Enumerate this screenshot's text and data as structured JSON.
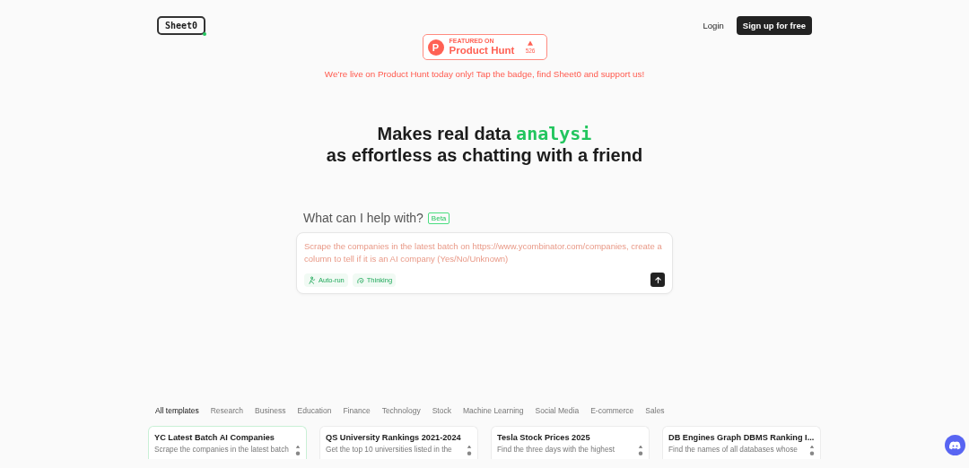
{
  "header": {
    "logo": "Sheet0",
    "login": "Login",
    "signup": "Sign up for free"
  },
  "badge": {
    "icon_letter": "P",
    "caption": "FEATURED ON",
    "name": "Product Hunt",
    "votes": "526"
  },
  "announcement": "We’re live on Product Hunt today only! Tap the badge, find Sheet0 and support us!",
  "headline": {
    "prefix": "Makes real data ",
    "highlight": "analysi",
    "line2": "as effortless as chatting with a friend"
  },
  "prompt": {
    "title": "What can I help with?",
    "tag": "Beta",
    "placeholder": "Scrape the companies in the latest batch on https://www.ycombinator.com/companies, create a column to tell if it is an AI company (Yes/No/Unknown)",
    "options": [
      {
        "kind": "autorun",
        "label": "Auto-run"
      },
      {
        "kind": "thinking",
        "label": "Thinking"
      }
    ]
  },
  "categories": [
    {
      "label": "All templates",
      "selected": true
    },
    {
      "label": "Research",
      "selected": false
    },
    {
      "label": "Business",
      "selected": false
    },
    {
      "label": "Education",
      "selected": false
    },
    {
      "label": "Finance",
      "selected": false
    },
    {
      "label": "Technology",
      "selected": false
    },
    {
      "label": "Stock",
      "selected": false
    },
    {
      "label": "Machine Learning",
      "selected": false
    },
    {
      "label": "Social Media",
      "selected": false
    },
    {
      "label": "E-commerce",
      "selected": false
    },
    {
      "label": "Sales",
      "selected": false
    }
  ],
  "templates": [
    {
      "title": "YC Latest Batch AI Companies",
      "description": "Scrape the companies in the latest batch",
      "selected": true
    },
    {
      "title": "QS University Rankings 2021-2024",
      "description": "Get the top 10 universities listed in the",
      "selected": false
    },
    {
      "title": "Tesla Stock Prices 2025",
      "description": "Find the three days with the highest",
      "selected": false
    },
    {
      "title": "DB Engines Graph DBMS Ranking I...",
      "description": "Find the names of all databases whose",
      "selected": false
    }
  ]
}
